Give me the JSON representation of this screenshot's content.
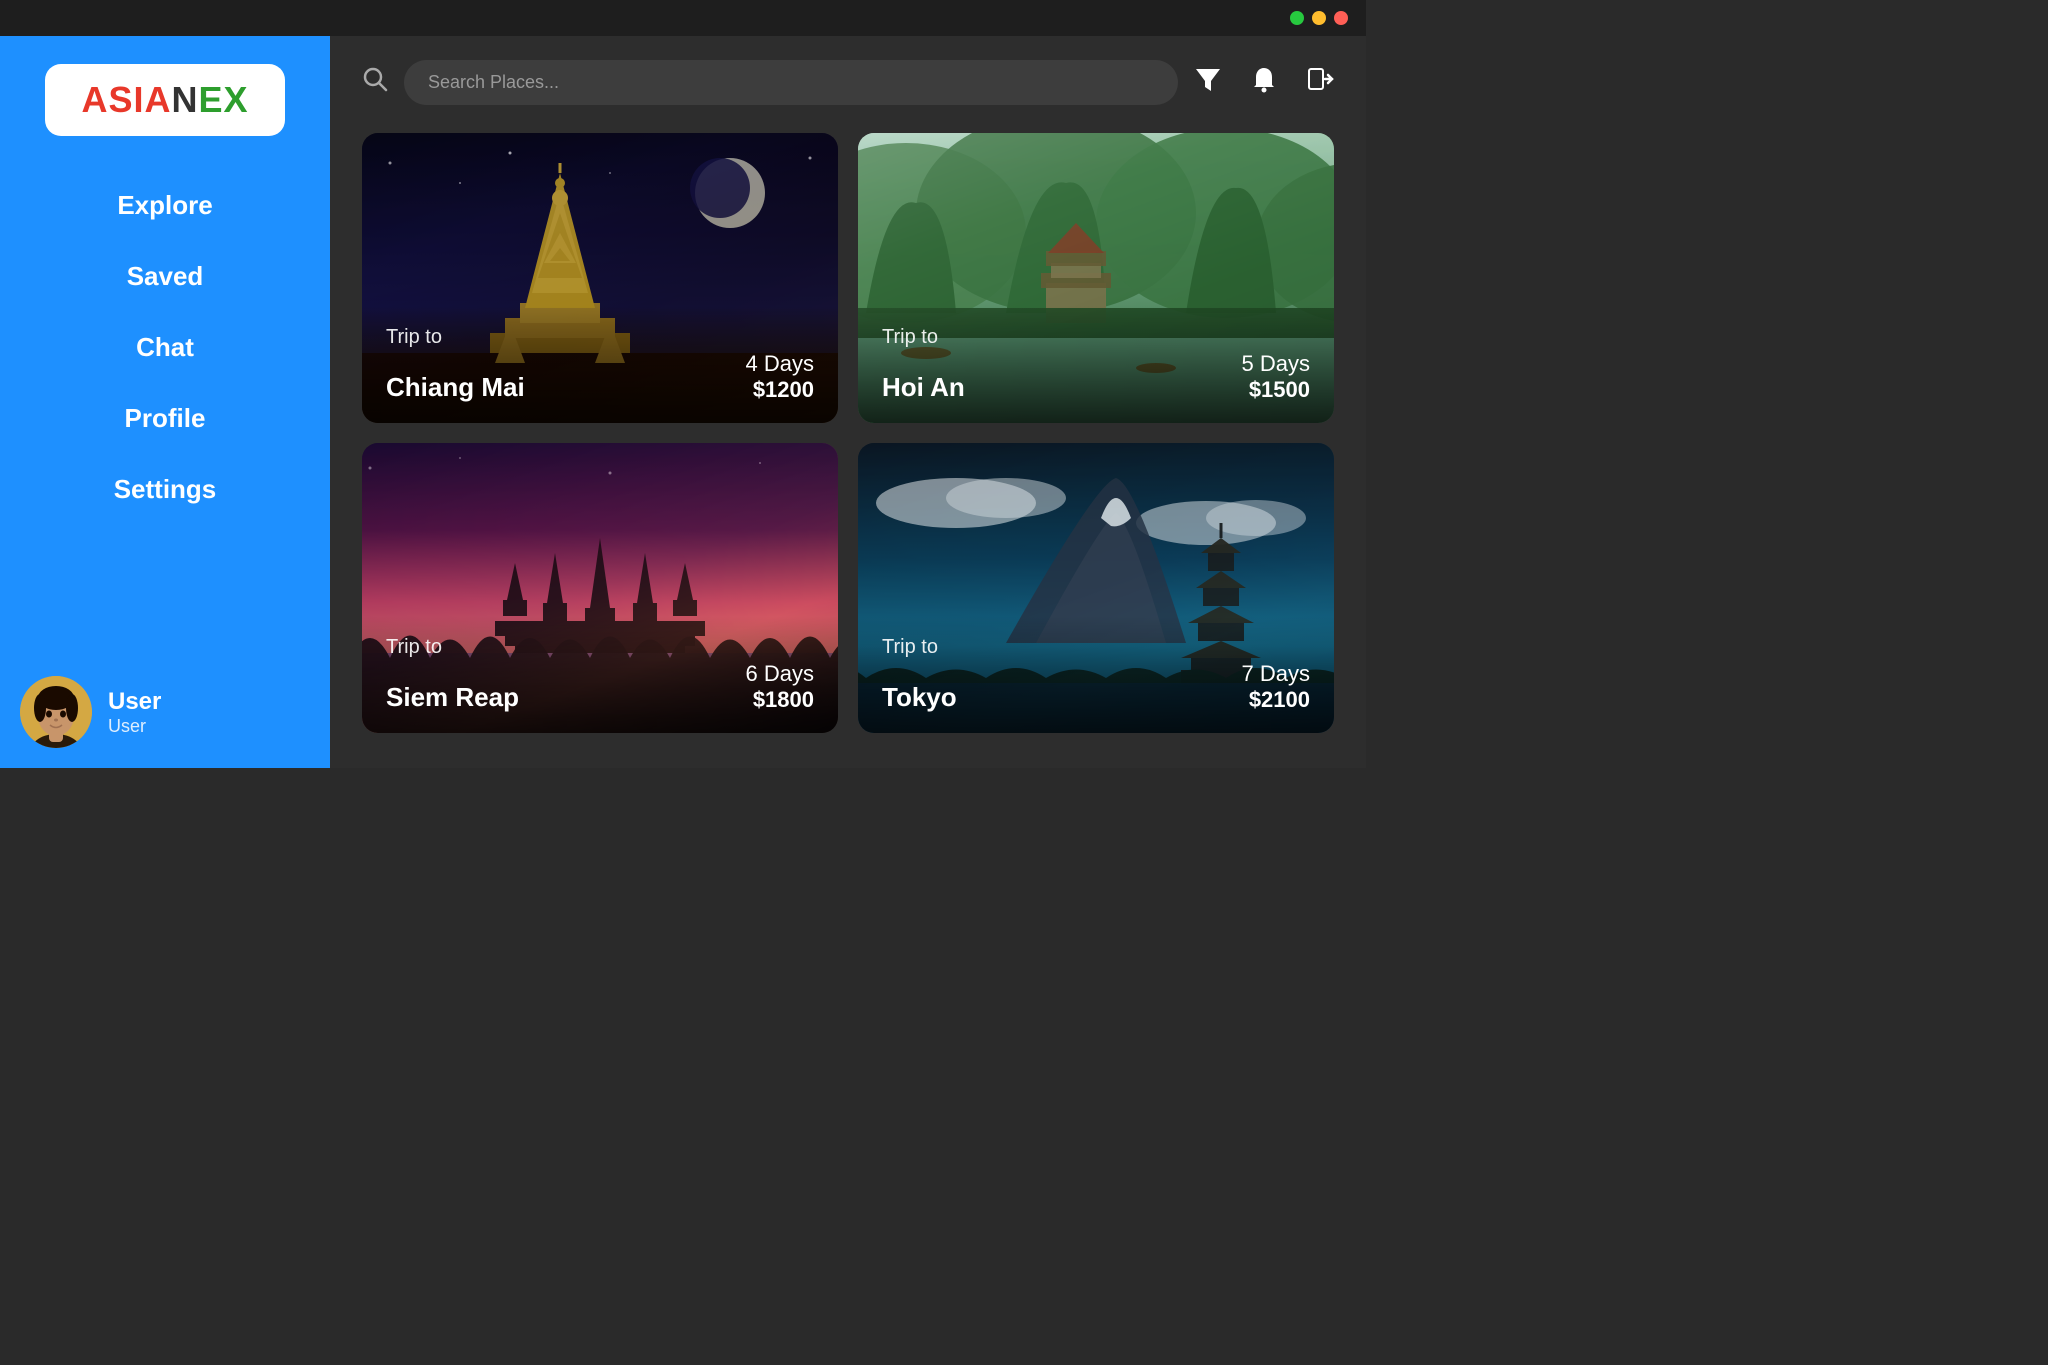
{
  "titlebar": {
    "buttons": [
      {
        "name": "green",
        "color": "#27c93f"
      },
      {
        "name": "yellow",
        "color": "#ffbd2e"
      },
      {
        "name": "red",
        "color": "#ff5f56"
      }
    ]
  },
  "sidebar": {
    "logo": {
      "asia": "ASIA",
      "n": "N",
      "ex": "EX"
    },
    "nav_items": [
      {
        "id": "explore",
        "label": "Explore"
      },
      {
        "id": "saved",
        "label": "Saved"
      },
      {
        "id": "chat",
        "label": "Chat"
      },
      {
        "id": "profile",
        "label": "Profile"
      },
      {
        "id": "settings",
        "label": "Settings"
      }
    ],
    "user": {
      "username": "User",
      "role": "User"
    }
  },
  "header": {
    "search_placeholder": "Search Places...",
    "filter_icon": "▼",
    "bell_icon": "🔔",
    "logout_icon": "⇥"
  },
  "cards": [
    {
      "id": "chiang-mai",
      "trip_label": "Trip to",
      "destination": "Chiang Mai",
      "days": "4 Days",
      "price": "$1200",
      "theme": "chiang-mai"
    },
    {
      "id": "hoi-an",
      "trip_label": "Trip to",
      "destination": "Hoi An",
      "days": "5 Days",
      "price": "$1500",
      "theme": "hoi-an"
    },
    {
      "id": "siem-reap",
      "trip_label": "Trip to",
      "destination": "Siem Reap",
      "days": "6 Days",
      "price": "$1800",
      "theme": "siem-reap"
    },
    {
      "id": "tokyo",
      "trip_label": "Trip to",
      "destination": "Tokyo",
      "days": "7 Days",
      "price": "$2100",
      "theme": "tokyo"
    }
  ]
}
